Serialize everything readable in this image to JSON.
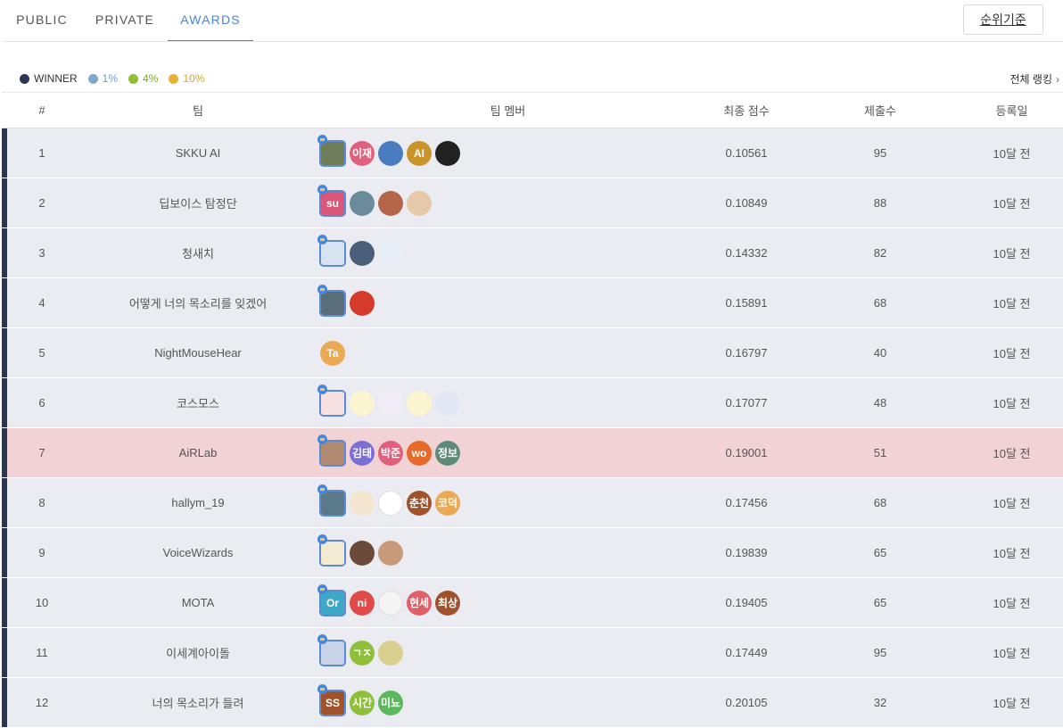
{
  "tabs": [
    {
      "label": "PUBLIC",
      "active": false
    },
    {
      "label": "PRIVATE",
      "active": false
    },
    {
      "label": "AWARDS",
      "active": true
    }
  ],
  "sort_button": "순위기준",
  "legend": [
    {
      "label": "WINNER",
      "color": "#2d3650",
      "text_color": "#333333"
    },
    {
      "label": "1%",
      "color": "#7fa8d0",
      "text_color": "#6a9bd6"
    },
    {
      "label": "4%",
      "color": "#8fbf3a",
      "text_color": "#7aa830"
    },
    {
      "label": "10%",
      "color": "#e7b22e",
      "text_color": "#d9a32a"
    }
  ],
  "all_ranking": "전체 랭킹",
  "columns": {
    "rank": "#",
    "team": "팀",
    "members": "팀 멤버",
    "score": "최종 점수",
    "submissions": "제출수",
    "date": "등록일"
  },
  "rows": [
    {
      "rank": "1",
      "team": "SKKU AI",
      "score": "0.10561",
      "submissions": "95",
      "date": "10달 전",
      "highlight": false,
      "members": [
        {
          "text": "",
          "color": "#6e7c5a",
          "leader": true
        },
        {
          "text": "이재",
          "color": "#e0607e"
        },
        {
          "text": "",
          "color": "#4a7cc0"
        },
        {
          "text": "AI",
          "color": "#c9952a"
        },
        {
          "text": "",
          "color": "#222222"
        }
      ]
    },
    {
      "rank": "2",
      "team": "딥보이스 탐정단",
      "score": "0.10849",
      "submissions": "88",
      "date": "10달 전",
      "highlight": false,
      "members": [
        {
          "text": "su",
          "color": "#d9587a",
          "leader": true
        },
        {
          "text": "",
          "color": "#6b8a9a"
        },
        {
          "text": "",
          "color": "#b5654a"
        },
        {
          "text": "",
          "color": "#e6c9a8"
        }
      ]
    },
    {
      "rank": "3",
      "team": "청새치",
      "score": "0.14332",
      "submissions": "82",
      "date": "10달 전",
      "highlight": false,
      "members": [
        {
          "text": "",
          "color": "#d7e3f0",
          "leader": true
        },
        {
          "text": "",
          "color": "#4a5f7a"
        },
        {
          "text": "",
          "color": "#e8eef6"
        }
      ]
    },
    {
      "rank": "4",
      "team": "어떻게 너의 목소리를 잊겠어",
      "score": "0.15891",
      "submissions": "68",
      "date": "10달 전",
      "highlight": false,
      "members": [
        {
          "text": "",
          "color": "#5a6e7a",
          "leader": true
        },
        {
          "text": "",
          "color": "#d63a2a"
        }
      ]
    },
    {
      "rank": "5",
      "team": "NightMouseHear",
      "score": "0.16797",
      "submissions": "40",
      "date": "10달 전",
      "highlight": false,
      "members": [
        {
          "text": "Ta",
          "color": "#eaa955"
        }
      ]
    },
    {
      "rank": "6",
      "team": "코스모스",
      "score": "0.17077",
      "submissions": "48",
      "date": "10달 전",
      "highlight": false,
      "members": [
        {
          "text": "",
          "color": "#f7e1e3",
          "leader": true
        },
        {
          "text": "",
          "color": "#fbf6d0"
        },
        {
          "text": "",
          "color": "#f1ecf5"
        },
        {
          "text": "",
          "color": "#fbf6d0"
        },
        {
          "text": "",
          "color": "#e3e8f7"
        }
      ]
    },
    {
      "rank": "7",
      "team": "AiRLab",
      "score": "0.19001",
      "submissions": "51",
      "date": "10달 전",
      "highlight": true,
      "members": [
        {
          "text": "",
          "color": "#b08a70",
          "leader": true
        },
        {
          "text": "김태",
          "color": "#7b6ed6"
        },
        {
          "text": "박준",
          "color": "#e0607e"
        },
        {
          "text": "wo",
          "color": "#e86a2a"
        },
        {
          "text": "정보",
          "color": "#5e8a7a"
        }
      ]
    },
    {
      "rank": "8",
      "team": "hallym_19",
      "score": "0.17456",
      "submissions": "68",
      "date": "10달 전",
      "highlight": false,
      "members": [
        {
          "text": "",
          "color": "#5a7a8a",
          "leader": true
        },
        {
          "text": "",
          "color": "#f5e6d0"
        },
        {
          "text": "",
          "color": "#ffffff"
        },
        {
          "text": "춘천",
          "color": "#a0522d"
        },
        {
          "text": "코덕",
          "color": "#eaa955"
        }
      ]
    },
    {
      "rank": "9",
      "team": "VoiceWizards",
      "score": "0.19839",
      "submissions": "65",
      "date": "10달 전",
      "highlight": false,
      "members": [
        {
          "text": "",
          "color": "#f3ead2",
          "leader": true
        },
        {
          "text": "",
          "color": "#6b4a3a"
        },
        {
          "text": "",
          "color": "#c89a7a"
        }
      ]
    },
    {
      "rank": "10",
      "team": "MOTA",
      "score": "0.19405",
      "submissions": "65",
      "date": "10달 전",
      "highlight": false,
      "members": [
        {
          "text": "Or",
          "color": "#3fa8c8",
          "leader": true
        },
        {
          "text": "ni",
          "color": "#e04a4a"
        },
        {
          "text": "",
          "color": "#f4f4f4"
        },
        {
          "text": "현세",
          "color": "#e0606a"
        },
        {
          "text": "최상",
          "color": "#a0522d"
        }
      ]
    },
    {
      "rank": "11",
      "team": "이세계아이돌",
      "score": "0.17449",
      "submissions": "95",
      "date": "10달 전",
      "highlight": false,
      "members": [
        {
          "text": "",
          "color": "#c9d3e8",
          "leader": true
        },
        {
          "text": "ㄱㅈ",
          "color": "#8fbf3a"
        },
        {
          "text": "",
          "color": "#d9d090"
        }
      ]
    },
    {
      "rank": "12",
      "team": "너의 목소리가 들려",
      "score": "0.20105",
      "submissions": "32",
      "date": "10달 전",
      "highlight": false,
      "members": [
        {
          "text": "SS",
          "color": "#a0522d",
          "leader": true
        },
        {
          "text": "시간",
          "color": "#8fbf3a"
        },
        {
          "text": "미뇨",
          "color": "#5cb85c"
        }
      ]
    }
  ]
}
